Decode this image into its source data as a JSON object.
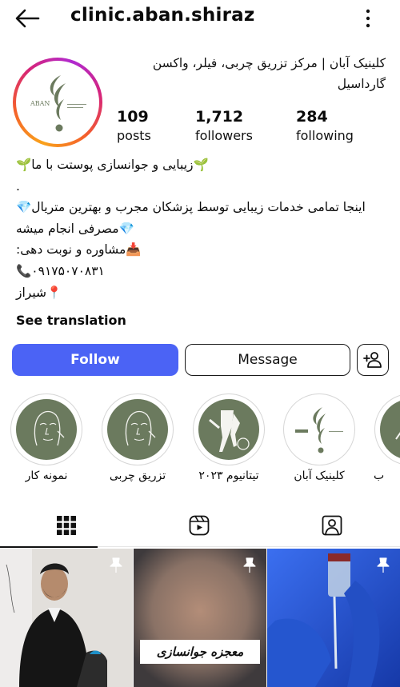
{
  "header": {
    "username": "clinic.aban.shiraz",
    "back_icon": "arrow-left-icon",
    "more_icon": "more-vertical-icon"
  },
  "profile": {
    "display_name": "کلینیک آبان | مرکز تزریق چربی، فیلر، واکسن گارداسیل",
    "avatar_logo_text": "ABAN",
    "stats": [
      {
        "value": "109",
        "label": "posts"
      },
      {
        "value": "1,712",
        "label": "followers"
      },
      {
        "value": "284",
        "label": "following"
      }
    ],
    "bio_lines": [
      "🌱زیبایی و جوانسازی پوستت با ما🌱",
      ".",
      "اینجا تمامی خدمات زیبایی توسط پزشکان مجرب و بهترین متریال💎",
      "💎مصرفی انجام میشه",
      "📥مشاوره و نوبت دهی:",
      "📞۰۹۱۷۵۰۷۰۸۳۱",
      "📍شیراز"
    ],
    "see_translation": "See translation"
  },
  "actions": {
    "follow": "Follow",
    "message": "Message",
    "add_user_icon": "add-user-icon"
  },
  "highlights": [
    {
      "label": "نمونه کار",
      "icon": "face-sketch"
    },
    {
      "label": "تزریق چربی",
      "icon": "face-sketch"
    },
    {
      "label": "تیتانیوم ۲۰۲۳",
      "icon": "laser-legs"
    },
    {
      "label": "کلینیک آبان",
      "icon": "aban-logo"
    },
    {
      "label": "ب",
      "icon": "partial"
    }
  ],
  "tabs": [
    {
      "name": "grid",
      "icon": "grid-icon",
      "active": true
    },
    {
      "name": "reels",
      "icon": "reels-icon",
      "active": false
    },
    {
      "name": "tagged",
      "icon": "tagged-icon",
      "active": false
    }
  ],
  "posts": [
    {
      "pinned": true,
      "overlay": ""
    },
    {
      "pinned": true,
      "overlay": "معجزه جوانسازی"
    },
    {
      "pinned": true,
      "overlay": ""
    }
  ],
  "colors": {
    "follow_button": "#4b63f5",
    "highlight_bg": "#6b7a5e",
    "story_ring": "#d6247a"
  }
}
